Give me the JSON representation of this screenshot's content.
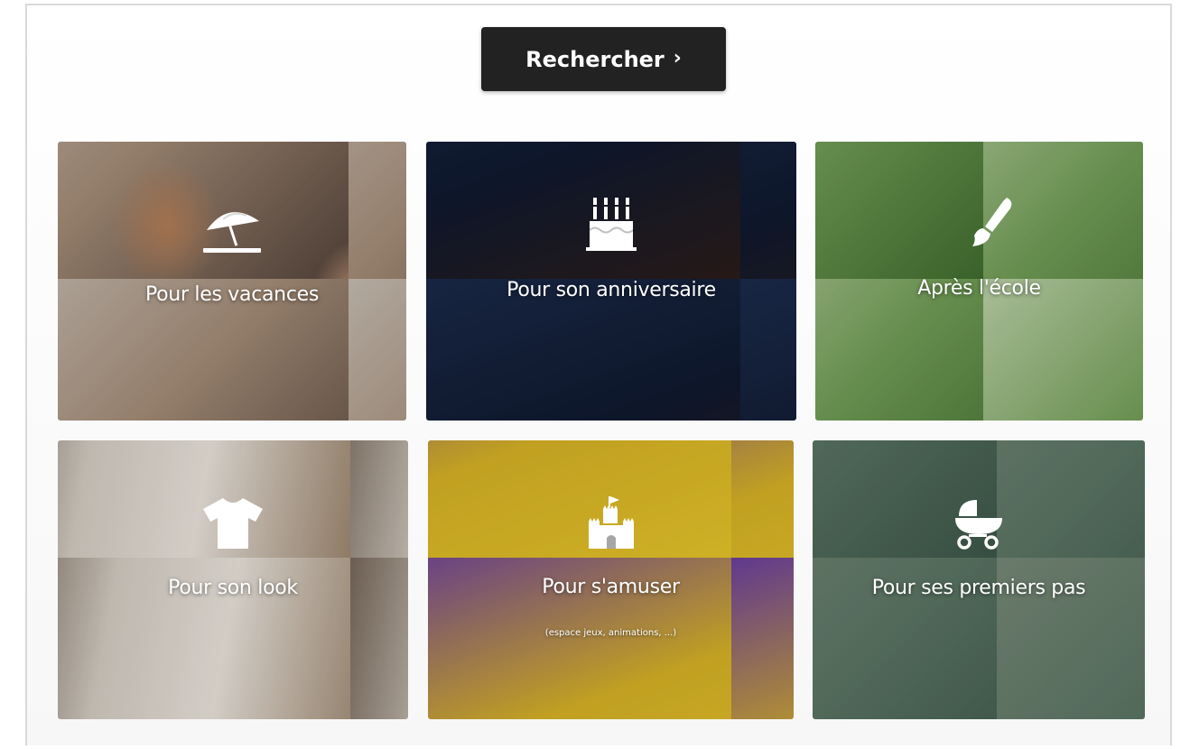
{
  "search": {
    "label": "Rechercher",
    "chevron": "›"
  },
  "tiles": [
    {
      "label": "Pour les vacances",
      "icon": "beach-umbrella-icon"
    },
    {
      "label": "Pour son anniversaire",
      "icon": "birthday-cake-icon"
    },
    {
      "label": "Après l'école",
      "icon": "paintbrush-icon"
    },
    {
      "label": "Pour son look",
      "icon": "t-shirt-icon"
    },
    {
      "label": "Pour s'amuser",
      "sublabel": "(espace jeux, animations, ...)",
      "icon": "sandcastle-icon"
    },
    {
      "label": "Pour ses premiers pas",
      "icon": "baby-stroller-icon"
    }
  ],
  "colors": {
    "button_bg": "#222222",
    "text_on_image": "#ffffff",
    "page_bg": "#ffffff"
  }
}
